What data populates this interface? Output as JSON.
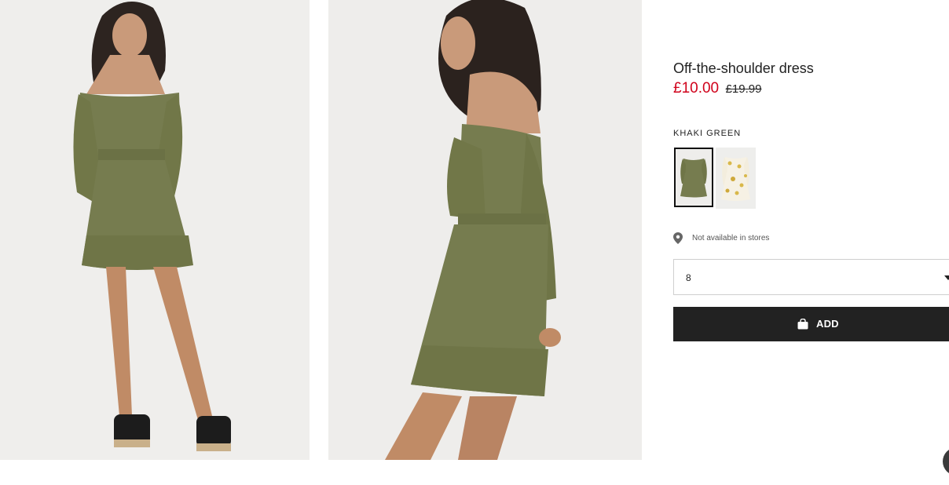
{
  "product": {
    "title": "Off-the-shoulder dress",
    "price_sale": "£10.00",
    "price_original": "£19.99",
    "sale_color": "#d0021b"
  },
  "colour": {
    "selected_label": "KHAKI GREEN",
    "swatches": [
      {
        "name": "khaki-green",
        "color": "#767c4f",
        "selected": true
      },
      {
        "name": "floral-print",
        "color": "#d9b84a",
        "selected": false
      }
    ]
  },
  "store": {
    "availability_text": "Not available in stores",
    "icon": "location-pin-icon"
  },
  "size_select": {
    "value": "8",
    "icon": "chevron-down-icon"
  },
  "add_button": {
    "label": "ADD",
    "icon": "shopping-bag-icon",
    "color": "#222222"
  },
  "chat": {
    "icon": "chat-bubble-icon"
  }
}
